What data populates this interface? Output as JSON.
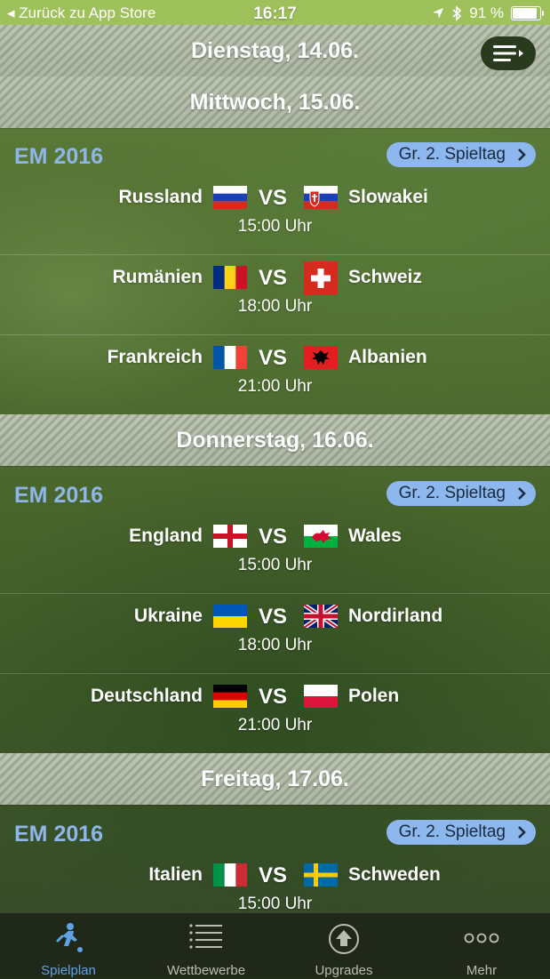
{
  "status": {
    "back": "Zurück zu App Store",
    "time": "16:17",
    "battery": "91 %",
    "battery_level": 0.91
  },
  "days": [
    {
      "label": "Dienstag, 14.06."
    },
    {
      "label": "Mittwoch, 15.06.",
      "competition": "EM 2016",
      "round": "Gr. 2. Spieltag",
      "matches": [
        {
          "home": "Russland",
          "away": "Slowakei",
          "time": "15:00 Uhr",
          "home_flag": "russia-flag",
          "away_flag": "slovakia-flag"
        },
        {
          "home": "Rumänien",
          "away": "Schweiz",
          "time": "18:00 Uhr",
          "home_flag": "romania-flag",
          "away_flag": "switzerland-flag"
        },
        {
          "home": "Frankreich",
          "away": "Albanien",
          "time": "21:00 Uhr",
          "home_flag": "france-flag",
          "away_flag": "albania-flag"
        }
      ]
    },
    {
      "label": "Donnerstag, 16.06.",
      "competition": "EM 2016",
      "round": "Gr. 2. Spieltag",
      "matches": [
        {
          "home": "England",
          "away": "Wales",
          "time": "15:00 Uhr",
          "home_flag": "england-flag",
          "away_flag": "wales-flag"
        },
        {
          "home": "Ukraine",
          "away": "Nordirland",
          "time": "18:00 Uhr",
          "home_flag": "ukraine-flag",
          "away_flag": "uk-flag"
        },
        {
          "home": "Deutschland",
          "away": "Polen",
          "time": "21:00 Uhr",
          "home_flag": "germany-flag",
          "away_flag": "poland-flag"
        }
      ]
    },
    {
      "label": "Freitag, 17.06.",
      "competition": "EM 2016",
      "round": "Gr. 2. Spieltag",
      "matches": [
        {
          "home": "Italien",
          "away": "Schweden",
          "time": "15:00 Uhr",
          "home_flag": "italy-flag",
          "away_flag": "sweden-flag"
        }
      ]
    }
  ],
  "vs_label": "VS",
  "tabs": [
    {
      "label": "Spielplan",
      "icon": "soccer-player-icon",
      "active": true
    },
    {
      "label": "Wettbewerbe",
      "icon": "list-icon",
      "active": false
    },
    {
      "label": "Upgrades",
      "icon": "upload-circle-icon",
      "active": false
    },
    {
      "label": "Mehr",
      "icon": "more-dots-icon",
      "active": false
    }
  ],
  "colors": {
    "accent": "#5fa3e6",
    "competition": "#8fb6e8",
    "pill": "#8db8ee",
    "statusbar": "#9fc15b"
  }
}
